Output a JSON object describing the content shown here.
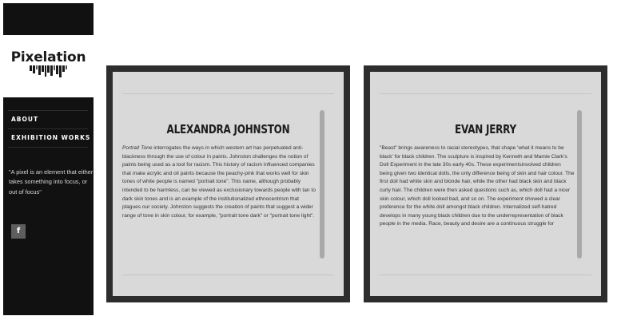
{
  "site": {
    "logo_text": "Pixelation"
  },
  "sidebar": {
    "nav": [
      {
        "label": "ABOUT"
      },
      {
        "label": "EXHIBITION WORKS"
      }
    ],
    "quote": "\"A pixel is an element that either takes something into focus, or out of focus\"",
    "social": {
      "facebook_label": "f"
    }
  },
  "cards": [
    {
      "title": "ALEXANDRA JOHNSTON",
      "text_italic": "Portrait Tone",
      "text": " interrogates the ways in which western art has perpetuated anti-blackness through the use of colour in paints. Johnston challenges the notion of paints being used as a tool for racism. This history of racism influenced companies that make acrylic and oil paints because the peachy-pink that works well for skin tones of white people is named \"portrait tone\". This name, although probably intended to be harmless, can be viewed as exclusionary towards people with tan to dark skin tones and is an example of the institutionalized ethnocentrism that plagues our society. Johnston suggests the creation of paints that suggest a wider range of tone in skin colour, for example, \"portrait tone dark\" or \"portrait tone light\"."
    },
    {
      "title": "EVAN JERRY",
      "text": "\"Beast\" brings awareness to racial stereotypes, that shape 'what it means to be black' for black children. The sculpture is inspired by Kenneth and Mamie Clark's Doll Experiment in the late 30s early 40s. These experimentsinvolved children being given two identical dolls, the only difference being of skin and hair colour. The first doll had white skin and blonde hair, while the other had black skin and black curly hair. The children were then asked questions such as, which doll had a nicer skin colour, which doll looked bad, and so on. The experiment showed a clear preference for the white doll amongst black children. Internalized self-hatred develops in many young black children due to the underrepresentation of black people in the media. Race, beauty and desire are a continuous struggle for"
    }
  ]
}
